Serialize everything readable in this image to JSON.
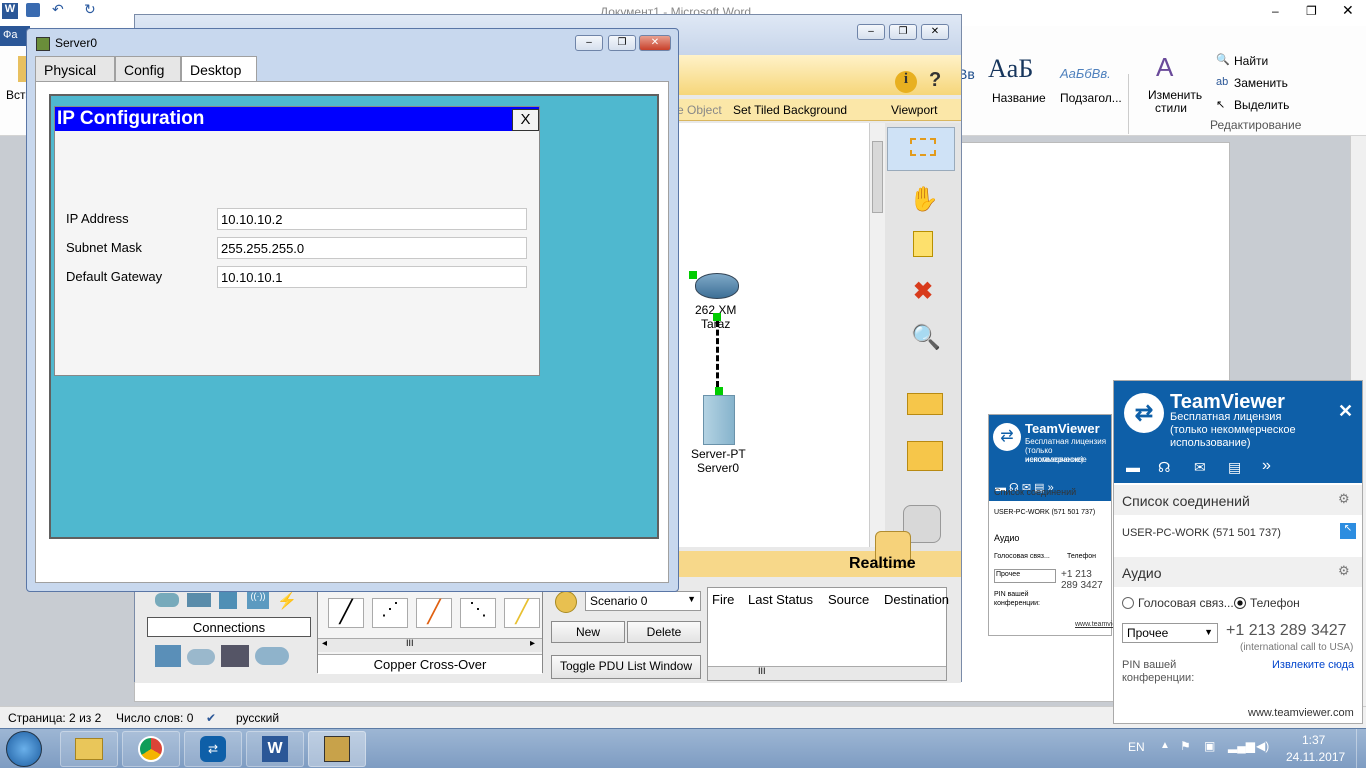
{
  "word": {
    "title": "Документ1 - Microsoft Word",
    "file_tab": "Фа",
    "paste": "Вста",
    "styles": [
      "Название",
      "Подзагол..."
    ],
    "style_sample_1": "AaБ",
    "style_sample_2": "AaБбВв.",
    "change_styles_1": "Изменить",
    "change_styles_2": "стили",
    "find": "Найти",
    "replace": "Заменить",
    "select": "Выделить",
    "editing": "Редактирование",
    "status_page": "Страница: 2 из 2",
    "status_words": "Число слов: 0",
    "status_lang": "русский"
  },
  "taskbar": {
    "lang": "EN",
    "time": "1:37",
    "date": "24.11.2017"
  },
  "pt": {
    "toolbar_object": "e Object",
    "set_tiled": "Set Tiled Background",
    "viewport": "Viewport",
    "router_label_1": "262 XM",
    "router_label_2": "Taraz",
    "server_label_1": "Server-PT",
    "server_label_2": "Server0",
    "realtime": "Realtime",
    "connections": "Connections",
    "copper": "Copper Cross-Over",
    "scenario": "Scenario 0",
    "new": "New",
    "delete": "Delete",
    "toggle_pdu": "Toggle PDU List Window",
    "cols": [
      "Fire",
      "Last Status",
      "Source",
      "Destination"
    ],
    "scroll_glyph": "III"
  },
  "dialog": {
    "title": "Server0",
    "tabs": [
      "Physical",
      "Config",
      "Desktop"
    ],
    "ip_header": "IP Configuration",
    "close_x": "X",
    "ip_label": "IP Address",
    "ip_value": "10.10.10.2",
    "mask_label": "Subnet Mask",
    "mask_value": "255.255.255.0",
    "gw_label": "Default Gateway",
    "gw_value": "10.10.10.1"
  },
  "tv": {
    "brand": "TeamViewer",
    "license_1": "Бесплатная лицензия",
    "license_2": "(только некоммерческое",
    "license_3": "использование)",
    "connections": "Список соединений",
    "partner": "USER-PC-WORK (571 501 737)",
    "audio": "Аудио",
    "voice": "Голосовая связ...",
    "phone": "Телефон",
    "other": "Прочее",
    "number": "+1 213 289 3427",
    "intl": "(international call to USA)",
    "pin_1": "PIN вашей",
    "pin_2": "конференции:",
    "extract": "Извлеките сюда",
    "site": "www.teamviewer.com"
  },
  "colors": {
    "accent_blue": "#0000ff",
    "teal": "#4fb8cf",
    "tv_blue": "#0e5fa8"
  }
}
